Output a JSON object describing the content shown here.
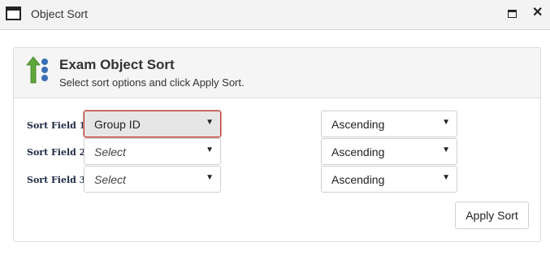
{
  "window": {
    "title": "Object Sort",
    "app_icon": "window-icon",
    "maximize_icon": "maximize-icon",
    "close_icon": "close-icon",
    "close_glyph": "✕"
  },
  "panel": {
    "icon": "sort-icon",
    "title": "Exam Object Sort",
    "subtitle": "Select sort options and click Apply Sort."
  },
  "rows": [
    {
      "label": "Sort Field 1:",
      "field_value": "Group ID",
      "field_is_placeholder": false,
      "direction": "Ascending"
    },
    {
      "label": "Sort Field 2:",
      "field_value": "Select",
      "field_is_placeholder": true,
      "direction": "Ascending"
    },
    {
      "label": "Sort Field 3:",
      "field_value": "Select",
      "field_is_placeholder": true,
      "direction": "Ascending"
    }
  ],
  "apply_button": {
    "label": "Apply Sort"
  },
  "colors": {
    "focus_border": "#c0392b",
    "header_bg": "#f5f5f5",
    "label_text": "#1f2a44",
    "arrow_green": "#5ea83a",
    "ball_blue": "#3a6fb5"
  }
}
